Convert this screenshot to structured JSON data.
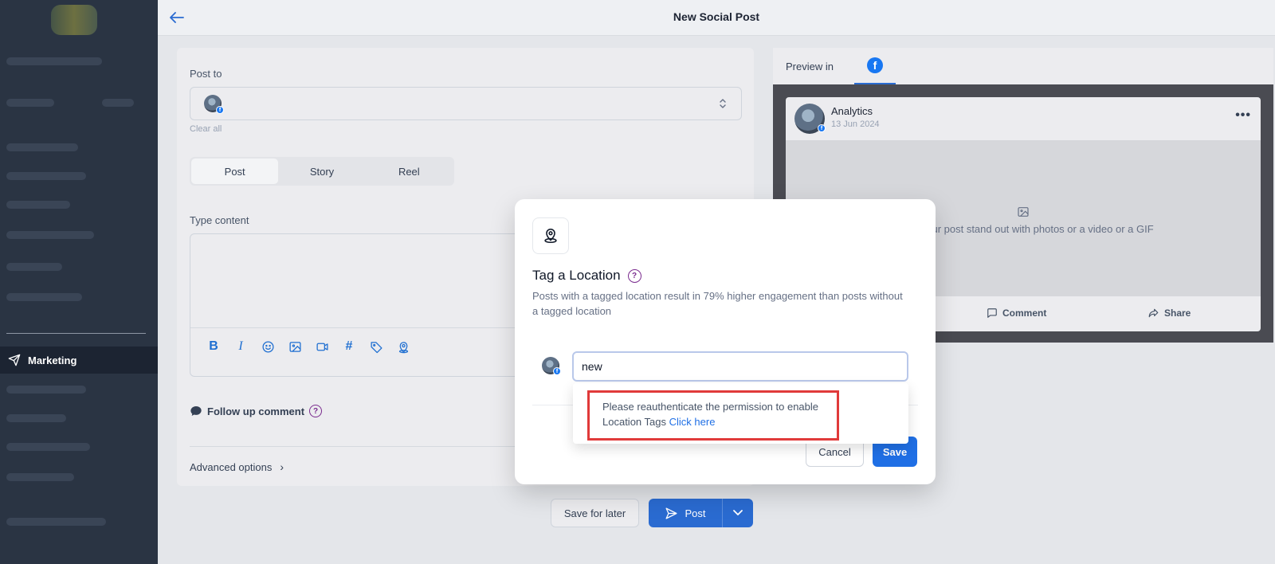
{
  "header": {
    "title": "New Social Post"
  },
  "sidebar": {
    "active_item": "Marketing"
  },
  "composer": {
    "post_to_label": "Post to",
    "clear_all": "Clear all",
    "type_tabs": [
      "Post",
      "Story",
      "Reel"
    ],
    "active_type": "Post",
    "content_label": "Type content",
    "follow_up": "Follow up comment",
    "advanced": "Advanced options"
  },
  "actions": {
    "save_later": "Save for later",
    "post": "Post"
  },
  "preview": {
    "label": "Preview in",
    "account_name": "Analytics",
    "date": "13 Jun 2024",
    "media_placeholder": "Make your post stand out with photos or a video or a GIF",
    "comment": "Comment",
    "share": "Share"
  },
  "modal": {
    "title": "Tag a Location",
    "description": "Posts with a tagged location result in 79% higher engagement than posts without a tagged location",
    "input_value": "new",
    "cancel": "Cancel",
    "save": "Save"
  },
  "dropdown": {
    "message": "Please reauthenticate the permission to enable Location Tags",
    "link": "Click here"
  },
  "colors": {
    "accent": "#1f6fe5",
    "facebook": "#1877f2",
    "highlight": "#e03a3a",
    "sidebar_bg": "#2a3443"
  }
}
